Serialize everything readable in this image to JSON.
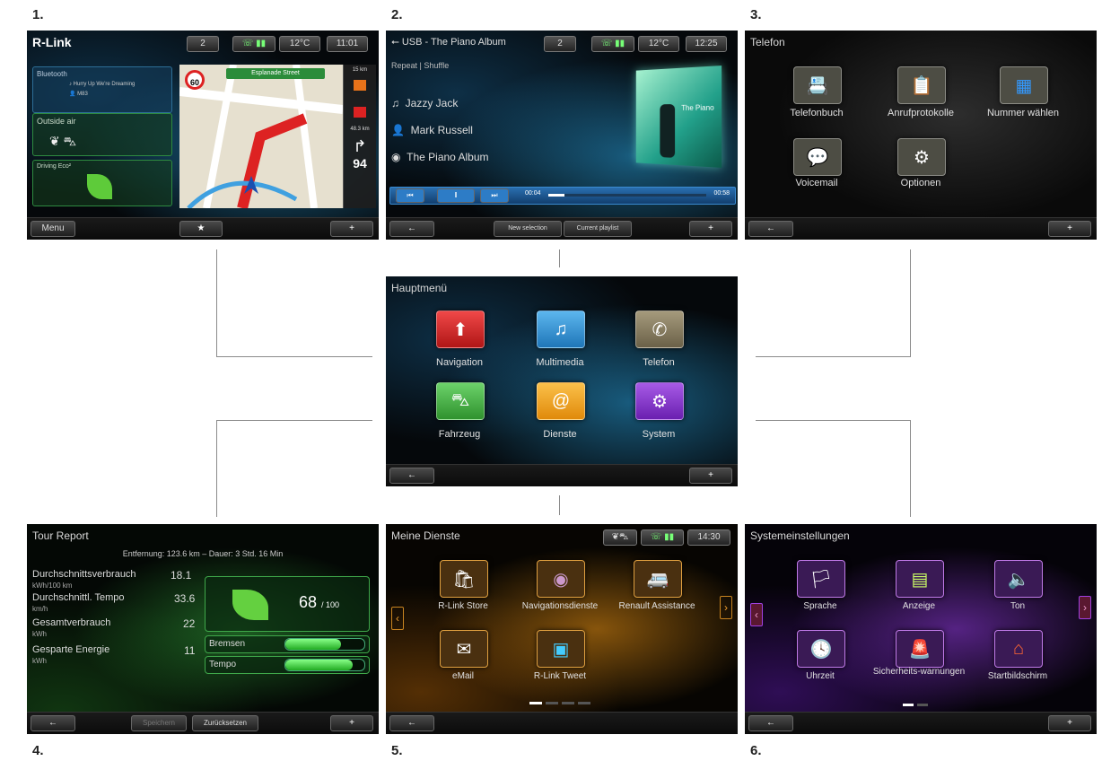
{
  "labels": [
    "1.",
    "2.",
    "3.",
    "4.",
    "5.",
    "6."
  ],
  "colors": {
    "nav": "#d92a2a",
    "multimedia": "#3c9ad6",
    "telefon": "#8a7f63",
    "fahrzeug": "#48b54a",
    "dienste": "#f2a11a",
    "system": "#8a3bd4"
  },
  "screen1": {
    "logo": "R-Link",
    "status": [
      "2",
      "12°C",
      "11:01"
    ],
    "bluetooth_title": "Bluetooth",
    "bluetooth_track": "Hurry Up We're Dreaming",
    "bluetooth_artist": "M83",
    "outside_title": "Outside air",
    "driving_title": "Driving Eco²",
    "speed_limit": "60",
    "street": "Esplanade Street",
    "dist_top": "15 km",
    "dist_mid": "48.3 km",
    "turn_number": "94",
    "menu_label": "Menu",
    "star_label": "★",
    "plus_label": "+"
  },
  "screen2": {
    "source": "USB - The Piano Album",
    "status": [
      "2",
      "12°C",
      "12:25"
    ],
    "mode": "Repeat | Shuffle",
    "song": "Jazzy Jack",
    "artist": "Mark Russell",
    "album": "The Piano Album",
    "album_art_text": "The Piano",
    "time_current": "00:04",
    "time_total": "00:58",
    "progress": 0.1,
    "btn_new": "New selection",
    "btn_playlist": "Current playlist",
    "back": "←",
    "plus": "+"
  },
  "screen3": {
    "title": "Telefon",
    "items": [
      "Telefonbuch",
      "Anrufprotokolle",
      "Nummer wählen",
      "Voicemail",
      "Optionen"
    ],
    "back": "←",
    "plus": "+"
  },
  "center": {
    "title": "Hauptmenü",
    "items": [
      "Navigation",
      "Multimedia",
      "Telefon",
      "Fahrzeug",
      "Dienste",
      "System"
    ],
    "back": "←",
    "plus": "+"
  },
  "screen4": {
    "title": "Tour Report",
    "summary": "Entfernung: 123.6 km – Dauer: 3 Std. 16 Min",
    "rows": [
      {
        "label": "Durchschnittsverbrauch",
        "unit": "kWh/100 km",
        "value": "18.1"
      },
      {
        "label": "Durchschnittl. Tempo",
        "unit": "km/h",
        "value": "33.6"
      },
      {
        "label": "Gesamtverbrauch",
        "unit": "kWh",
        "value": "22"
      },
      {
        "label": "Gesparte Energie",
        "unit": "kWh",
        "value": "11"
      }
    ],
    "score": "68",
    "score_max": "/ 100",
    "bremsen": "Bremsen",
    "bremsen_level": 0.7,
    "tempo": "Tempo",
    "tempo_level": 0.85,
    "btn_save": "Speichern",
    "btn_reset": "Zurücksetzen",
    "back": "←",
    "plus": "+"
  },
  "screen5": {
    "title": "Meine Dienste",
    "status": [
      "14:30"
    ],
    "items": [
      "R-Link Store",
      "Navigationsdienste",
      "Renault Assistance",
      "eMail",
      "R-Link Tweet"
    ],
    "back": "←"
  },
  "screen6": {
    "title": "Systemeinstellungen",
    "items": [
      "Sprache",
      "Anzeige",
      "Ton",
      "Uhrzeit",
      "Sicherheits-warnungen",
      "Startbildschirm"
    ],
    "back": "←",
    "plus": "+"
  }
}
